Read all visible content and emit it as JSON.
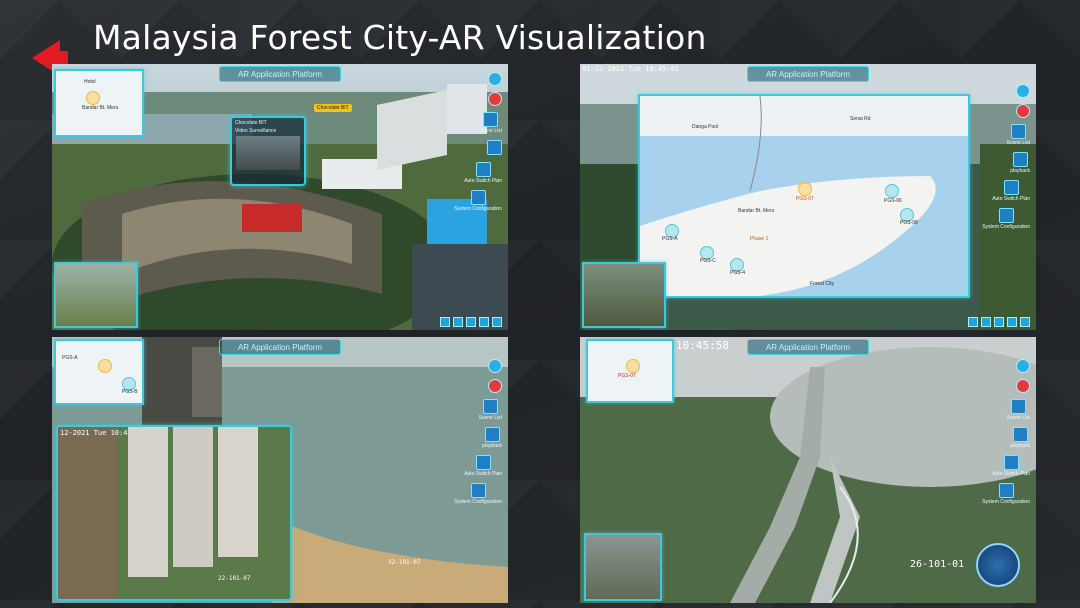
{
  "slide": {
    "title": "Malaysia Forest City-AR Visualization",
    "accent_color": "#e21b22"
  },
  "panels": [
    {
      "header": "AR Application Platform",
      "popup_title": "Chocolate BIT",
      "popup_subtitle": "Video Surveillance",
      "tag": "Chocolate BIT",
      "side_buttons": [
        "Scene List",
        "",
        "Auto Switch Plan",
        "System Configuration"
      ],
      "map_labels": [
        "Bandar Bt. Meru",
        "Hotel"
      ]
    },
    {
      "timestamp": "01-12-2021 Tue 10:45:42",
      "header": "AR Application Platform",
      "side_buttons": [
        "Scene List",
        "playback",
        "Auto Switch Plan",
        "System Configuration"
      ],
      "map_labels": [
        "Danga Pool",
        "Bandar Bt. Meru",
        "PGS-07",
        "PGS-06",
        "PGS-08",
        "PGS-A",
        "PGS-C",
        "PGS-4",
        "Phase 1",
        "Forest City",
        "Senai Rd"
      ]
    },
    {
      "timestamp": "12-2021 Tue 10:4",
      "header": "AR Application Platform",
      "side_buttons": [
        "Scene List",
        "playback",
        "Auto Switch Plan",
        "System Configuration"
      ],
      "map_labels": [
        "PGS-A",
        "PGS-B"
      ],
      "footer_labels": [
        "22-101-07",
        "32-101-07"
      ]
    },
    {
      "timestamp": "10:45:58",
      "header": "AR Application Platform",
      "side_buttons": [
        "Scene List",
        "playback",
        "Auto Switch Plan",
        "System Configuration"
      ],
      "map_labels": [
        "PGS-07"
      ],
      "camera_label": "26-101-01"
    }
  ]
}
